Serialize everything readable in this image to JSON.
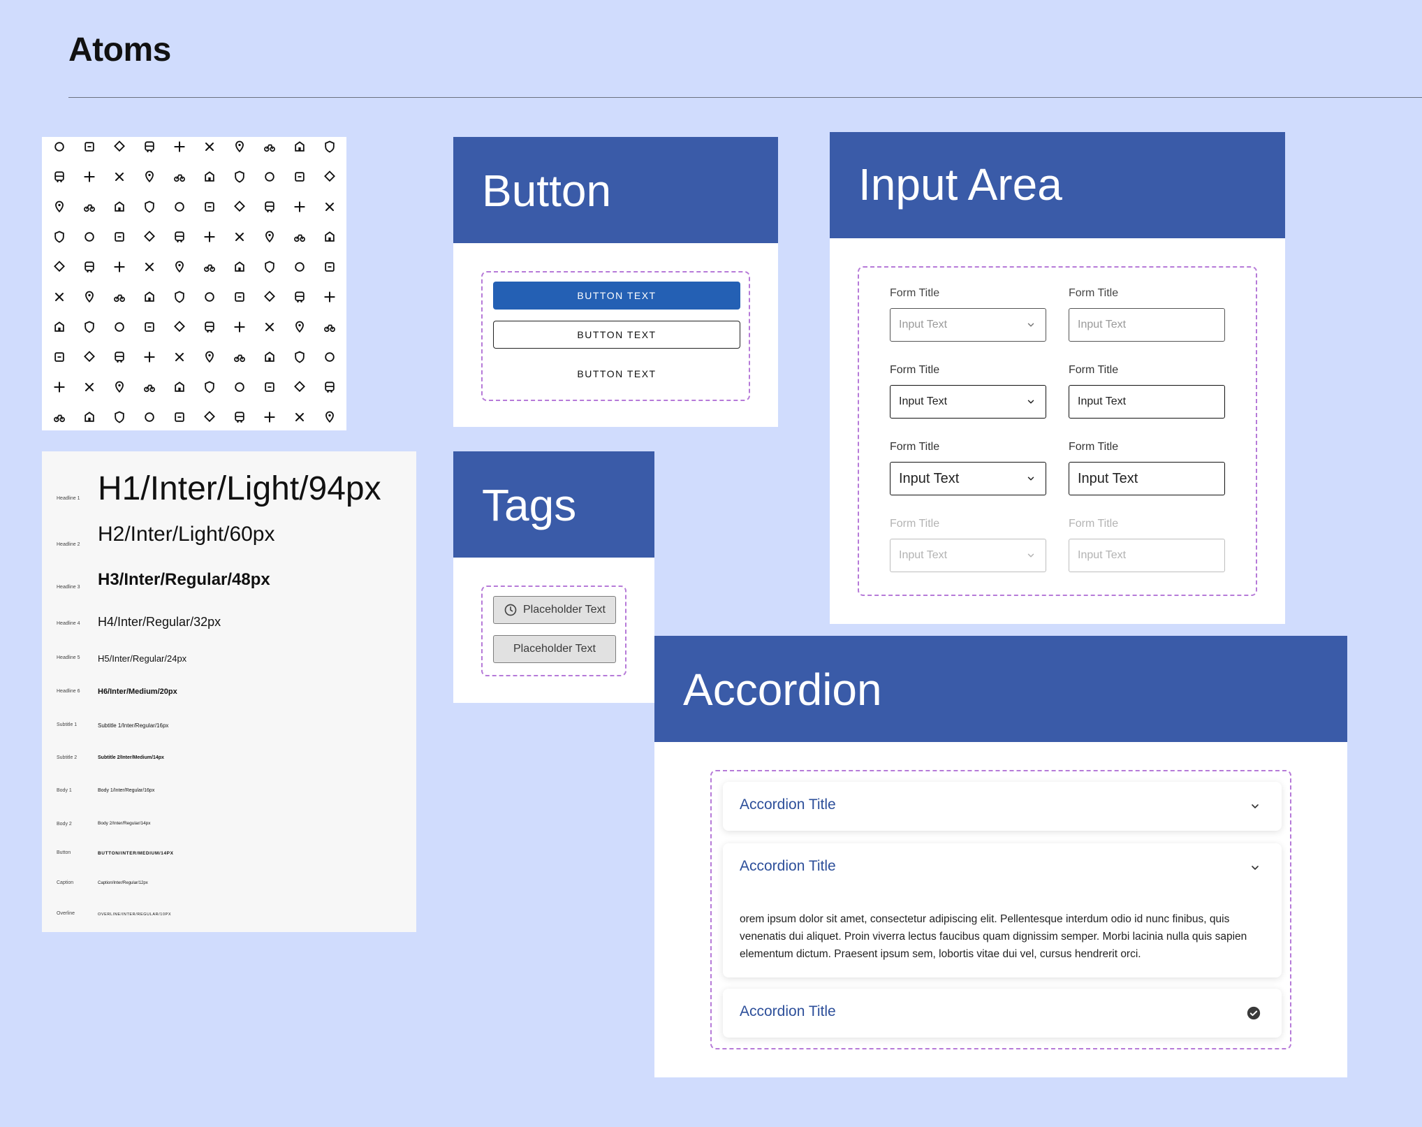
{
  "page": {
    "title": "Atoms"
  },
  "icons": [
    [
      "link",
      "fuel",
      "pin",
      "add-location",
      "equalizer",
      "motorcycle",
      "merge",
      "fold",
      "fork",
      "atm"
    ],
    [
      "settings",
      "badge",
      "stadium",
      "shield",
      "cyclist",
      "food",
      "ramp",
      "bus-info",
      "station",
      "train"
    ],
    [
      "castle",
      "shapes",
      "party",
      "family",
      "cleaning",
      "wifi",
      "stairs",
      "bikes",
      "map-search",
      "crossed-tools"
    ],
    [
      "diamond",
      "bed-side",
      "diamond-sign",
      "bike",
      "ferry",
      "train-front",
      "bus",
      "bus-2",
      "car",
      "car-2"
    ],
    [
      "tram",
      "tram-2",
      "runner",
      "metro",
      "metro-2",
      "metro-3",
      "metro-4",
      "hiker",
      "accessible",
      "capsule"
    ],
    [
      "verified",
      "check-shield",
      "gas-station",
      "water-drop",
      "vinyl",
      "bike-2",
      "car-front",
      "motor",
      "delivery",
      "scooter"
    ],
    [
      "swim",
      "medical",
      "phone-list",
      "restaurant-menu",
      "museum",
      "airplane",
      "toilet",
      "forest",
      "fort",
      "skier"
    ],
    [
      "tools",
      "dispensary",
      "briefcase",
      "bed",
      "safe",
      "ice-cream",
      "beer",
      "layers",
      "no-signal",
      "water-bottle"
    ],
    [
      "ticket",
      "flight",
      "money",
      "cocktail",
      "coffee",
      "locomotive",
      "sofa",
      "cutlery",
      "delete",
      "fire"
    ],
    [
      "shield-pattern",
      "fuel-2",
      "cart",
      "add-box",
      "hotel",
      "door",
      "shopping-bag",
      "package",
      "film",
      "tag"
    ]
  ],
  "typography": [
    {
      "label": "Headline 1",
      "sample": "H1/Inter/Light/94px"
    },
    {
      "label": "Headline 2",
      "sample": "H2/Inter/Light/60px"
    },
    {
      "label": "Headline 3",
      "sample": "H3/Inter/Regular/48px"
    },
    {
      "label": "Headline 4",
      "sample": "H4/Inter/Regular/32px"
    },
    {
      "label": "Headline 5",
      "sample": "H5/Inter/Regular/24px"
    },
    {
      "label": "Headline 6",
      "sample": "H6/Inter/Medium/20px"
    },
    {
      "label": "Subtitle 1",
      "sample": "Subtitle 1/Inter/Regular/16px"
    },
    {
      "label": "Subtitle 2",
      "sample": "Subtitle 2/Inter/Medium/14px"
    },
    {
      "label": "Body 1",
      "sample": "Body 1/Inter/Regular/16px"
    },
    {
      "label": "Body 2",
      "sample": "Body 2/Inter/Regular/14px"
    },
    {
      "label": "Button",
      "sample": "BUTTON/INTER/MEDIUM/14PX"
    },
    {
      "label": "Caption",
      "sample": "Caption/Inter/Regular/12px"
    },
    {
      "label": "Overline",
      "sample": "OVERLINE/INTER/REGULAR/10PX"
    }
  ],
  "button_card": {
    "title": "Button",
    "primary_label": "BUTTON TEXT",
    "outline_label": "BUTTON TEXT",
    "text_label": "BUTTON TEXT"
  },
  "tags_card": {
    "title": "Tags",
    "tag_with_icon": "Placeholder Text",
    "tag_plain": "Placeholder Text"
  },
  "input_card": {
    "title": "Input Area",
    "rows": [
      {
        "state": "placeholder",
        "left_title": "Form Title",
        "left_value": "Input Text",
        "right_title": "Form Title",
        "right_value": "Input Text"
      },
      {
        "state": "filled",
        "left_title": "Form Title",
        "left_value": "Input Text",
        "right_title": "Form Title",
        "right_value": "Input Text"
      },
      {
        "state": "focus",
        "left_title": "Form Title",
        "left_value": "Input Text",
        "right_title": "Form Title",
        "right_value": "Input Text"
      },
      {
        "state": "disabled",
        "left_title": "Form Title",
        "left_value": "Input Text",
        "right_title": "Form Title",
        "right_value": "Input Text"
      }
    ]
  },
  "accordion_card": {
    "title": "Accordion",
    "items": [
      {
        "title": "Accordion Title",
        "state": "collapsed"
      },
      {
        "title": "Accordion Title",
        "state": "expanded",
        "body": "orem ipsum dolor sit amet, consectetur adipiscing elit. Pellentesque interdum odio id nunc finibus, quis venenatis dui aliquet. Proin viverra lectus faucibus quam dignissim semper. Morbi lacinia nulla quis sapien elementum dictum. Praesent ipsum sem, lobortis vitae dui vel, cursus hendrerit orci."
      },
      {
        "title": "Accordion Title",
        "state": "completed"
      }
    ]
  },
  "colors": {
    "background": "#d0dcfd",
    "card_header": "#3a5ba8",
    "primary_button": "#2460b4",
    "accordion_title": "#2d4f9a",
    "dashed_outline": "#b67ad8"
  }
}
